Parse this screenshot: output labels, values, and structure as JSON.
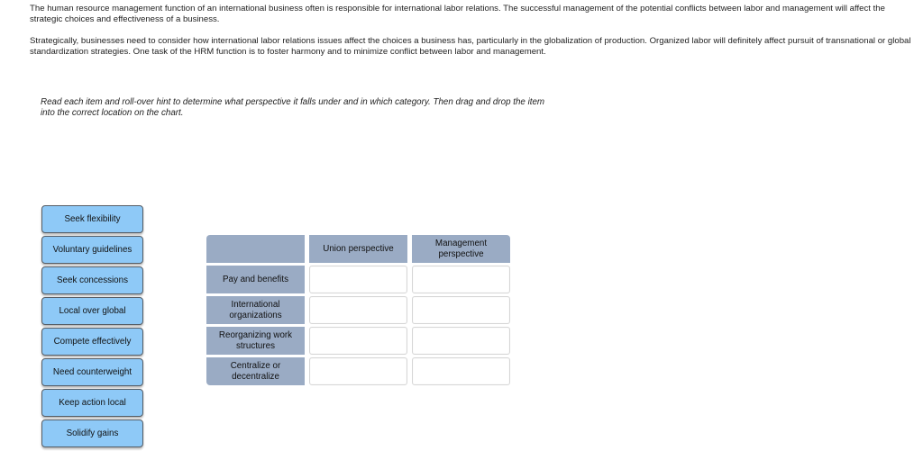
{
  "intro": {
    "paragraphs": [
      "The human resource management function of an international business often is responsible for international labor relations. The successful management of the potential conflicts between labor and management will affect the strategic choices and effectiveness of a business.",
      "Strategically, businesses need to consider how international labor relations issues affect the choices a business has, particularly in the globalization of production. Organized labor will definitely affect pursuit of transnational or global standardization strategies. One task of the HRM function is to foster harmony and to minimize conflict between labor and management."
    ]
  },
  "instructions": "Read each item and roll-over hint to determine what perspective it falls under and in which category. Then drag and drop the item into the correct location on the chart.",
  "draggable_items": [
    {
      "label": "Seek flexibility"
    },
    {
      "label": "Voluntary guidelines"
    },
    {
      "label": "Seek concessions"
    },
    {
      "label": "Local over global"
    },
    {
      "label": "Compete effectively"
    },
    {
      "label": "Need counterweight"
    },
    {
      "label": "Keep action local"
    },
    {
      "label": "Solidify gains"
    }
  ],
  "chart": {
    "columns": [
      "",
      "Union perspective",
      "Management perspective"
    ],
    "rows": [
      {
        "category": "Pay and benefits",
        "union": "",
        "management": ""
      },
      {
        "category": "International organizations",
        "union": "",
        "management": ""
      },
      {
        "category": "Reorganizing work structures",
        "union": "",
        "management": ""
      },
      {
        "category": "Centralize or decentralize",
        "union": "",
        "management": ""
      }
    ]
  },
  "colors": {
    "item_fill": "#8ec9f7",
    "header_fill": "#9aabc4",
    "drop_zone_fill": "#ffffff"
  }
}
